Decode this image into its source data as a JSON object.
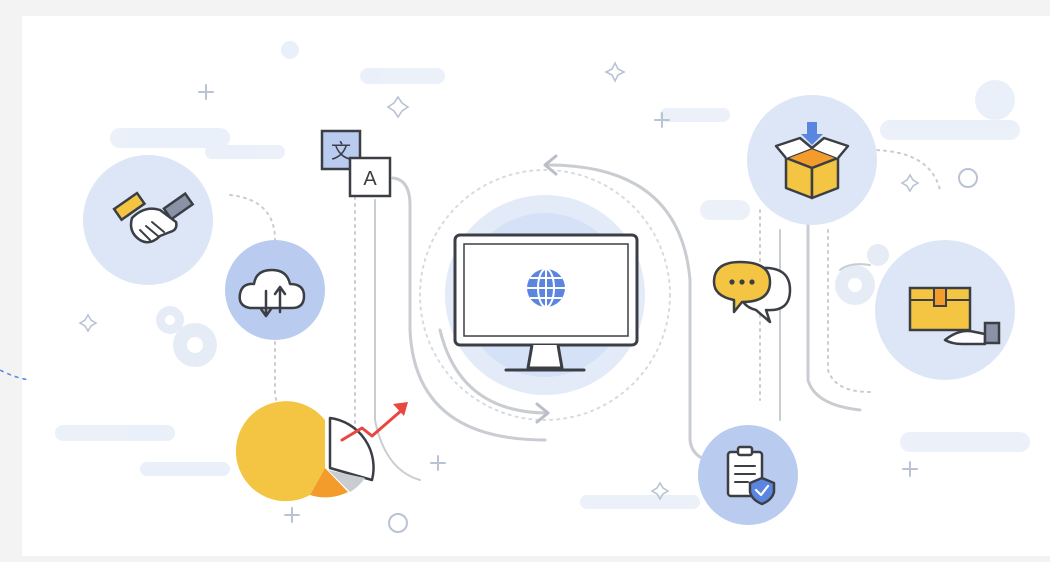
{
  "illustration": {
    "translate_card_glyphs": {
      "source": "文",
      "target": "A"
    },
    "colors": {
      "background": "#f3f3f3",
      "panel": "#ffffff",
      "circle_light": "#dfe8f7",
      "circle_mid": "#c3d4f1",
      "accent_blue": "#5b86e0",
      "accent_yellow": "#f4c542",
      "accent_orange": "#f39c2b",
      "arrow_red": "#e8473e",
      "line_gray": "#c9ccd1",
      "outline": "#3b3f45"
    },
    "icons": [
      "handshake-icon",
      "cloud-sync-icon",
      "translate-icon",
      "pie-chart-growth-icon",
      "monitor-globe-icon",
      "chat-bubbles-icon",
      "checklist-shield-icon",
      "package-download-icon",
      "package-delivery-icon"
    ]
  }
}
